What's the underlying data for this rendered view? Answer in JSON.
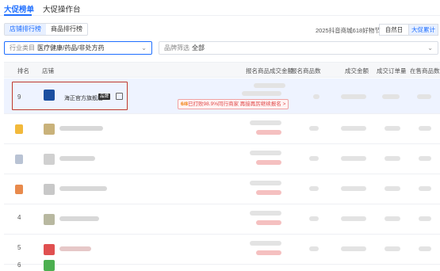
{
  "tabs": {
    "promo_rank": "大促榜单",
    "promo_ops": "大促操作台"
  },
  "subtabs": {
    "store_rank": "店铺排行榜",
    "product_rank": "商品排行榜"
  },
  "festival_label": "2025抖音商城618好物节",
  "date_toggle": {
    "natural_day": "自然日",
    "promo_cumulative": "大促累计"
  },
  "filters": {
    "industry_label": "行业类目",
    "industry_value": "医疗健康/药品/非处方药",
    "brand_label": "品牌筛选",
    "brand_value": "全部"
  },
  "table": {
    "headers": [
      "排名",
      "店铺",
      "报名商品成交金额",
      "报名商品数",
      "成交金额",
      "成交订单量",
      "在售商品数"
    ],
    "highlighted": {
      "rank": "9",
      "store_name": "海正官方旗舰店",
      "brand_badge": "品牌",
      "tip_prefix": "6/8",
      "tip_text": "已打败98.9%同行商家 再接再厉继续报名 >"
    },
    "rows": [
      {
        "rank_type": "medal",
        "medal_color": "#f2b93b"
      },
      {
        "rank_type": "medal",
        "medal_color": "#b9c3d4"
      },
      {
        "rank_type": "medal",
        "medal_color": "#e88a4c"
      },
      {
        "rank_type": "text",
        "rank": "4"
      },
      {
        "rank_type": "text",
        "rank": "5"
      },
      {
        "rank_type": "text",
        "rank": "6"
      }
    ]
  }
}
